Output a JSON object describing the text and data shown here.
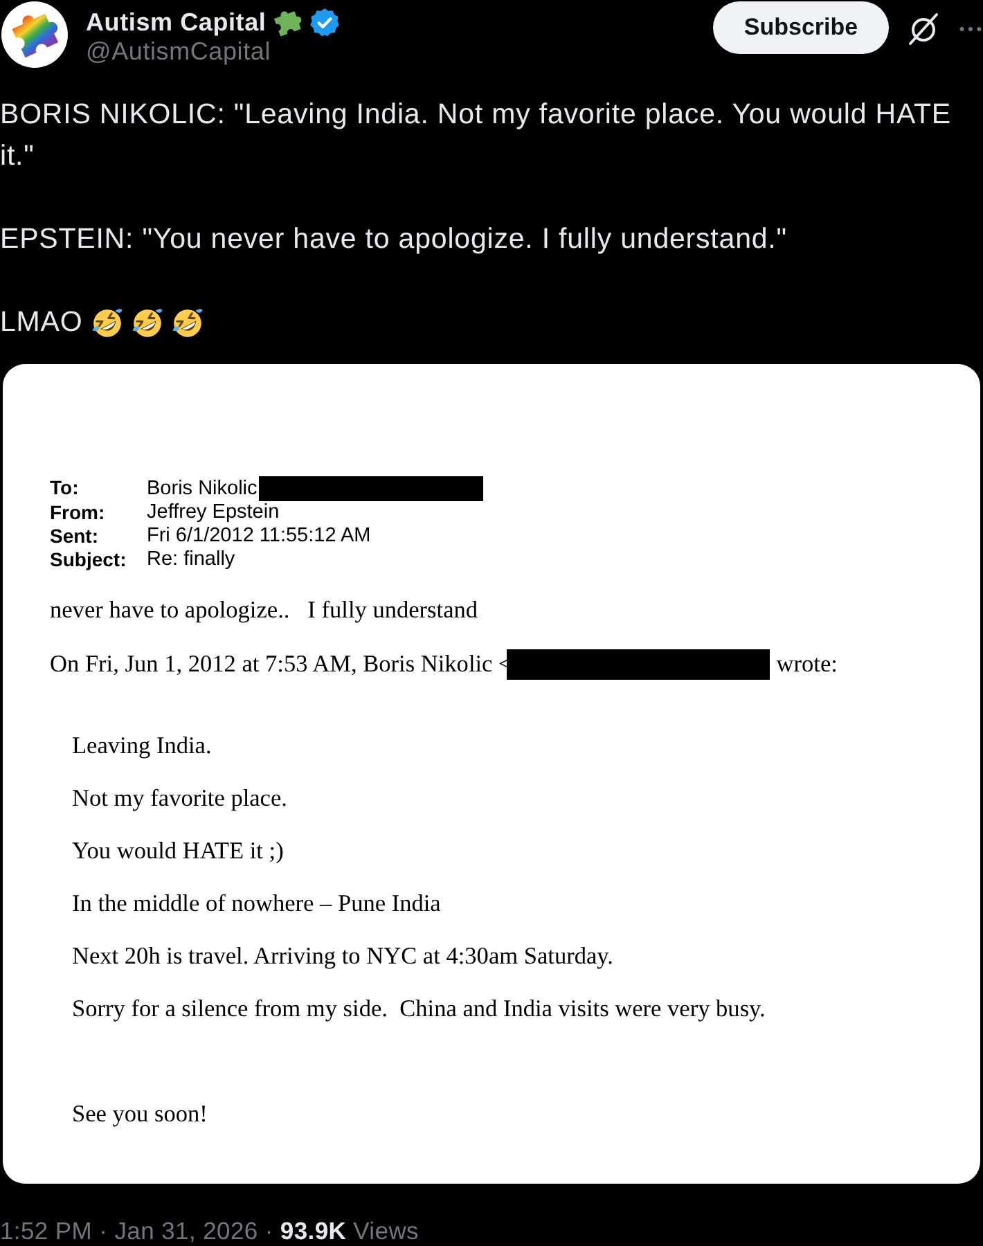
{
  "author": {
    "name": "Autism Capital",
    "handle": "@AutismCapital",
    "verified": true
  },
  "subscribe_button": {
    "label": "Subscribe"
  },
  "post": {
    "paragraphs": [
      {
        "text": "BORIS NIKOLIC: \"Leaving India. Not my favorite place. You would HATE it.\""
      },
      {
        "text": "EPSTEIN: \"You never have to apologize. I fully understand.\""
      },
      {
        "text": "LMAO",
        "emojis": [
          {
            "kind": "rofl"
          },
          {
            "kind": "rofl"
          },
          {
            "kind": "rofl"
          }
        ]
      }
    ]
  },
  "attachment": {
    "headers": [
      {
        "label": "To:",
        "value": "Boris Nikolic",
        "redacted": true
      },
      {
        "label": "From:",
        "value": "Jeffrey Epstein",
        "redacted": false
      },
      {
        "label": "Sent:",
        "value": "Fri 6/1/2012 11:55:12 AM",
        "redacted": false
      },
      {
        "label": "Subject:",
        "value": "Re: finally",
        "redacted": false
      }
    ],
    "reply": "never have to apologize..   I fully understand",
    "quote_intro": {
      "before": "On Fri, Jun 1, 2012 at 7:53 AM, Boris Nikolic <",
      "redacted": true,
      "after": "wrote:"
    },
    "quoted_lines": [
      "Leaving India.",
      "Not my favorite place.",
      "You would HATE it ;)",
      "In the middle of nowhere – Pune India",
      "Next 20h is travel. Arriving to NYC at 4:30am Saturday.",
      "Sorry for a silence from my side.  China and India visits were very busy."
    ],
    "signoff": "See you soon!"
  },
  "meta": {
    "timestamp": "1:52 PM · Jan 31, 2026 ·",
    "views_count": "93.9K",
    "views_label": "Views"
  }
}
